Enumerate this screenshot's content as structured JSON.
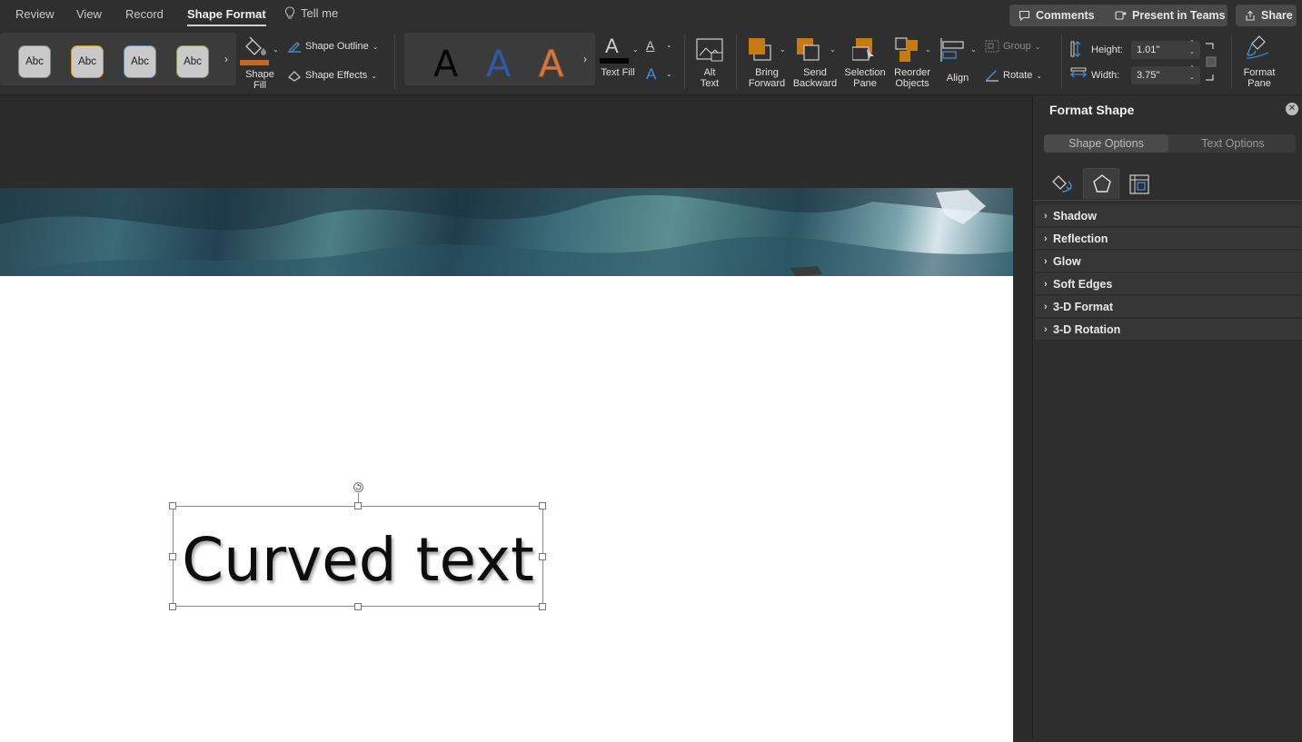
{
  "tabs": [
    {
      "label": "Review",
      "active": false
    },
    {
      "label": "View",
      "active": false
    },
    {
      "label": "Record",
      "active": false
    },
    {
      "label": "Shape Format",
      "active": true
    }
  ],
  "tell_me": "Tell me",
  "top_buttons": {
    "comments": "Comments",
    "present": "Present in Teams",
    "share": "Share"
  },
  "ribbon": {
    "shape_styles": [
      "Abc",
      "Abc",
      "Abc",
      "Abc"
    ],
    "shape_fill": [
      "Shape",
      "Fill"
    ],
    "shape_outline": "Shape Outline",
    "shape_effects": "Shape Effects",
    "wordart_styles": [
      "A",
      "A",
      "A"
    ],
    "text_fill": "Text Fill",
    "alt_text": [
      "Alt",
      "Text"
    ],
    "bring_forward": [
      "Bring",
      "Forward"
    ],
    "send_backward": [
      "Send",
      "Backward"
    ],
    "selection_pane": [
      "Selection",
      "Pane"
    ],
    "reorder_objects": [
      "Reorder",
      "Objects"
    ],
    "align": "Align",
    "group": "Group",
    "rotate": "Rotate",
    "height_label": "Height:",
    "height_value": "1.01\"",
    "width_label": "Width:",
    "width_value": "3.75\"",
    "format_pane": [
      "Format",
      "Pane"
    ]
  },
  "colors": {
    "fill_accent": "#c4691e",
    "orange_icon": "#c77a12",
    "wordart_blue": "#2f5aa8",
    "wordart_orange": "#d07a44"
  },
  "slide": {
    "textbox_text": "Curved text"
  },
  "pane": {
    "title": "Format Shape",
    "options": [
      {
        "label": "Shape Options",
        "active": true
      },
      {
        "label": "Text Options",
        "active": false
      }
    ],
    "icon_tabs": [
      "fill-line-icon",
      "effects-pentagon-icon",
      "size-properties-icon"
    ],
    "sections": [
      "Shadow",
      "Reflection",
      "Glow",
      "Soft Edges",
      "3-D Format",
      "3-D Rotation"
    ]
  }
}
